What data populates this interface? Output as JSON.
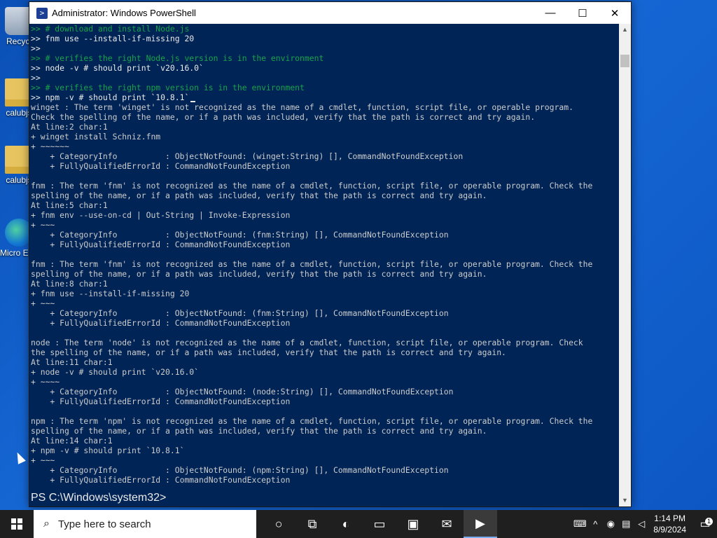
{
  "desktop": {
    "icons": [
      {
        "label": "Recycl",
        "kind": "recycle"
      },
      {
        "label": "calubjs",
        "kind": "folder"
      },
      {
        "label": "calubjs",
        "kind": "folder"
      },
      {
        "label": "Micro Edg",
        "kind": "edge"
      }
    ]
  },
  "window": {
    "title": "Administrator: Windows PowerShell",
    "minimize": "—",
    "maximize": "☐",
    "close": "✕"
  },
  "console": {
    "lines": [
      {
        "t": "cmt",
        "text": ">> # download and install Node.js"
      },
      {
        "t": "cmd",
        "text": ">> fnm use --install-if-missing 20"
      },
      {
        "t": "cmd",
        "text": ">>"
      },
      {
        "t": "cmt",
        "text": ">> # verifies the right Node.js version is in the environment"
      },
      {
        "t": "cmd",
        "text": ">> node -v # should print `v20.16.0`"
      },
      {
        "t": "cmd",
        "text": ">>"
      },
      {
        "t": "cmt",
        "text": ">> # verifies the right npm version is in the environment"
      },
      {
        "t": "cmd",
        "text": ">> npm -v # should print `10.8.1`"
      },
      {
        "t": "err",
        "text": "winget : The term 'winget' is not recognized as the name of a cmdlet, function, script file, or operable program."
      },
      {
        "t": "err",
        "text": "Check the spelling of the name, or if a path was included, verify that the path is correct and try again."
      },
      {
        "t": "err",
        "text": "At line:2 char:1"
      },
      {
        "t": "err",
        "text": "+ winget install Schniz.fnm"
      },
      {
        "t": "err",
        "text": "+ ~~~~~~"
      },
      {
        "t": "err",
        "text": "    + CategoryInfo          : ObjectNotFound: (winget:String) [], CommandNotFoundException"
      },
      {
        "t": "err",
        "text": "    + FullyQualifiedErrorId : CommandNotFoundException"
      },
      {
        "t": "blank",
        "text": ""
      },
      {
        "t": "err",
        "text": "fnm : The term 'fnm' is not recognized as the name of a cmdlet, function, script file, or operable program. Check the"
      },
      {
        "t": "err",
        "text": "spelling of the name, or if a path was included, verify that the path is correct and try again."
      },
      {
        "t": "err",
        "text": "At line:5 char:1"
      },
      {
        "t": "err",
        "text": "+ fnm env --use-on-cd | Out-String | Invoke-Expression"
      },
      {
        "t": "err",
        "text": "+ ~~~"
      },
      {
        "t": "err",
        "text": "    + CategoryInfo          : ObjectNotFound: (fnm:String) [], CommandNotFoundException"
      },
      {
        "t": "err",
        "text": "    + FullyQualifiedErrorId : CommandNotFoundException"
      },
      {
        "t": "blank",
        "text": ""
      },
      {
        "t": "err",
        "text": "fnm : The term 'fnm' is not recognized as the name of a cmdlet, function, script file, or operable program. Check the"
      },
      {
        "t": "err",
        "text": "spelling of the name, or if a path was included, verify that the path is correct and try again."
      },
      {
        "t": "err",
        "text": "At line:8 char:1"
      },
      {
        "t": "err",
        "text": "+ fnm use --install-if-missing 20"
      },
      {
        "t": "err",
        "text": "+ ~~~"
      },
      {
        "t": "err",
        "text": "    + CategoryInfo          : ObjectNotFound: (fnm:String) [], CommandNotFoundException"
      },
      {
        "t": "err",
        "text": "    + FullyQualifiedErrorId : CommandNotFoundException"
      },
      {
        "t": "blank",
        "text": ""
      },
      {
        "t": "err",
        "text": "node : The term 'node' is not recognized as the name of a cmdlet, function, script file, or operable program. Check"
      },
      {
        "t": "err",
        "text": "the spelling of the name, or if a path was included, verify that the path is correct and try again."
      },
      {
        "t": "err",
        "text": "At line:11 char:1"
      },
      {
        "t": "err",
        "text": "+ node -v # should print `v20.16.0`"
      },
      {
        "t": "err",
        "text": "+ ~~~~"
      },
      {
        "t": "err",
        "text": "    + CategoryInfo          : ObjectNotFound: (node:String) [], CommandNotFoundException"
      },
      {
        "t": "err",
        "text": "    + FullyQualifiedErrorId : CommandNotFoundException"
      },
      {
        "t": "blank",
        "text": ""
      },
      {
        "t": "err",
        "text": "npm : The term 'npm' is not recognized as the name of a cmdlet, function, script file, or operable program. Check the"
      },
      {
        "t": "err",
        "text": "spelling of the name, or if a path was included, verify that the path is correct and try again."
      },
      {
        "t": "err",
        "text": "At line:14 char:1"
      },
      {
        "t": "err",
        "text": "+ npm -v # should print `10.8.1`"
      },
      {
        "t": "err",
        "text": "+ ~~~"
      },
      {
        "t": "err",
        "text": "    + CategoryInfo          : ObjectNotFound: (npm:String) [], CommandNotFoundException"
      },
      {
        "t": "err",
        "text": "    + FullyQualifiedErrorId : CommandNotFoundException"
      }
    ],
    "prompt": "PS C:\\Windows\\system32>"
  },
  "taskbar": {
    "search_placeholder": "Type here to search",
    "apps": [
      {
        "name": "cortana-icon",
        "glyph": "○",
        "active": false
      },
      {
        "name": "task-view-icon",
        "glyph": "⧉",
        "active": false
      },
      {
        "name": "edge-icon",
        "glyph": "◐",
        "active": false
      },
      {
        "name": "file-explorer-icon",
        "glyph": "▭",
        "active": false
      },
      {
        "name": "store-icon",
        "glyph": "▣",
        "active": false
      },
      {
        "name": "mail-icon",
        "glyph": "✉",
        "active": false
      },
      {
        "name": "powershell-icon",
        "glyph": "▶",
        "active": true
      }
    ],
    "tray": {
      "time": "1:14 PM",
      "date": "8/9/2024",
      "notification_count": "1"
    }
  },
  "colors": {
    "console_bg": "#012456",
    "error_fg": "#ff2b2b",
    "comment_fg": "#16a34a"
  }
}
